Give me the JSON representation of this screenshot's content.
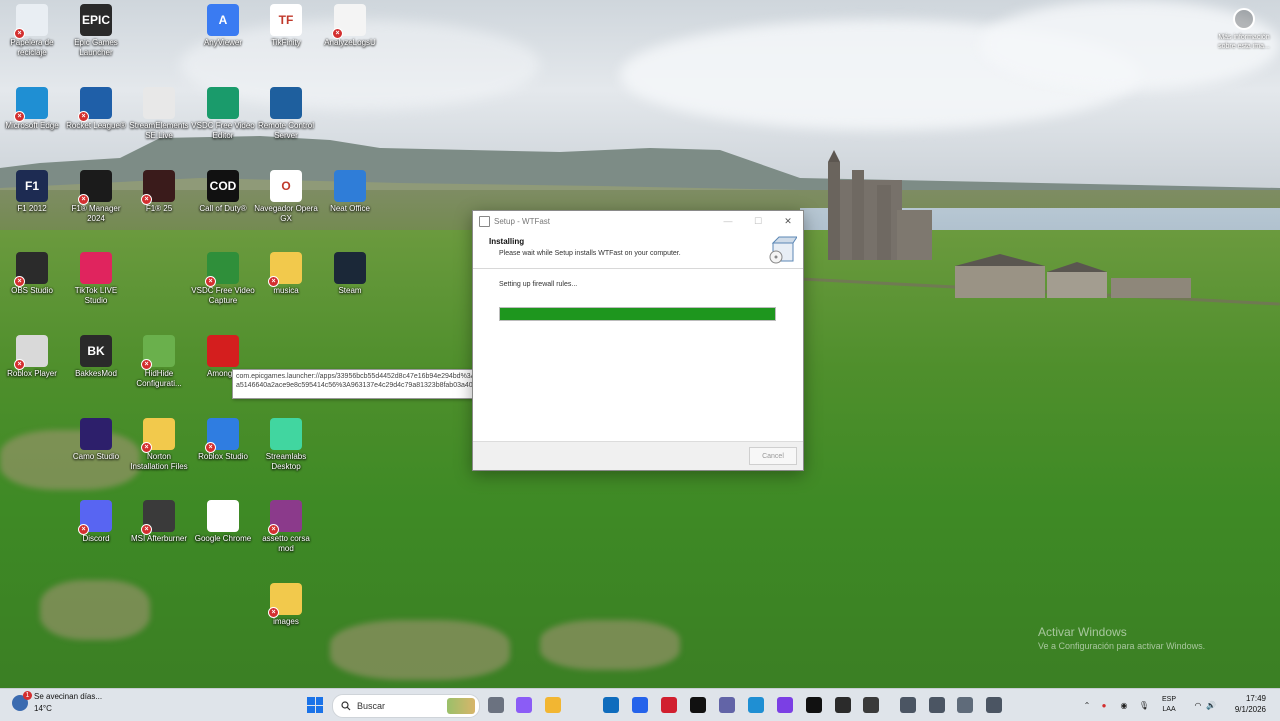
{
  "desktop": {
    "icons": [
      {
        "label": "Papelera de reciclaje",
        "color": "#e9eef3"
      },
      {
        "label": "Epic Games Launcher",
        "color": "#2a2a2a",
        "glyph": "EPIC"
      },
      {
        "label": "AnyViewer",
        "color": "#3a7bf2",
        "glyph": "A"
      },
      {
        "label": "TikFinity",
        "color": "#ffffff",
        "glyph": "TF"
      },
      {
        "label": "AnalyzeLogsU",
        "color": "#f4f4f4"
      },
      {
        "label": "Microsoft Edge",
        "color": "#1f8fd3"
      },
      {
        "label": "Rocket League®",
        "color": "#1f5fa8"
      },
      {
        "label": "StreamElements SE.Live",
        "color": "#e8e8e8"
      },
      {
        "label": "VSDC Free Video Editor",
        "color": "#1a9b6b"
      },
      {
        "label": "Remote Control Server",
        "color": "#1e5f9e"
      },
      {
        "label": "F1 2012",
        "color": "#1d2b52",
        "glyph": "F1"
      },
      {
        "label": "F1® Manager 2024",
        "color": "#1b1b1b"
      },
      {
        "label": "F1® 25",
        "color": "#3a1b1b"
      },
      {
        "label": "Call of Duty®",
        "color": "#111111",
        "glyph": "COD"
      },
      {
        "label": "Navegador Opera GX",
        "color": "#ffffff",
        "glyph": "O"
      },
      {
        "label": "Neat Office",
        "color": "#2f7dd8"
      },
      {
        "label": "OBS Studio",
        "color": "#2b2b2b"
      },
      {
        "label": "TikTok LIVE Studio",
        "color": "#e0245e"
      },
      {
        "label": "VSDC Free Video Capture",
        "color": "#2f8f3a"
      },
      {
        "label": "musica",
        "color": "#f2c94c"
      },
      {
        "label": "Steam",
        "color": "#1b2838"
      },
      {
        "label": "Roblox Player",
        "color": "#d9d9d9"
      },
      {
        "label": "BakkesMod",
        "color": "#2a2a2a",
        "glyph": "BK"
      },
      {
        "label": "HidHide Configurati...",
        "color": "#6ab04c"
      },
      {
        "label": "Among...",
        "color": "#d41e1e"
      },
      {
        "label": "Camo Studio",
        "color": "#2d1f6b"
      },
      {
        "label": "Norton Installation Files",
        "color": "#f2c94c"
      },
      {
        "label": "Roblox Studio",
        "color": "#2f7de1"
      },
      {
        "label": "Streamlabs Desktop",
        "color": "#41d6a0"
      },
      {
        "label": "Discord",
        "color": "#5865f2"
      },
      {
        "label": "MSI Afterburner",
        "color": "#3a3a3a"
      },
      {
        "label": "Google Chrome",
        "color": "#ffffff"
      },
      {
        "label": "assetto corsa mod",
        "color": "#8b3a8b"
      },
      {
        "label": "images",
        "color": "#f2c94c"
      }
    ],
    "tooltip": {
      "text": "com.epicgames.launcher://apps/33956bcb55d4452d8c47e16b94e294bd%3A729a86a5146640a2ace9e8c595414c56%3A963137e4c29d4c79a81323b8fab03a40?..."
    },
    "info_widget": {
      "label": "Más información sobre esta ima..."
    },
    "watermark": {
      "title": "Activar Windows",
      "subtitle": "Ve a Configuración para activar Windows."
    }
  },
  "setup_window": {
    "title": "Setup - WTFast",
    "close_glyph": "✕",
    "minimize_glyph": "—",
    "maximize_glyph": "☐",
    "heading": "Installing",
    "subheading": "Please wait while Setup installs WTFast on your computer.",
    "status": "Setting up firewall rules...",
    "progress": 1.0,
    "cancel_label": "Cancel",
    "progress_color": "#1e961e"
  },
  "taskbar": {
    "weather_text": "Se avecinan días...",
    "weather_temp": "14°C",
    "weather_badge": "1",
    "search_placeholder": "Buscar",
    "language_top": "ESP",
    "language_bottom": "LAA",
    "time": "17:49",
    "date": "9/1/2026",
    "app_icons": [
      {
        "name": "task-view-icon",
        "color": "#6b7280"
      },
      {
        "name": "copilot-icon",
        "color": "#8b5cf6"
      },
      {
        "name": "file-explorer-icon",
        "color": "#f2b632"
      },
      {
        "name": "outlook-icon",
        "color": "#0f6cbd"
      },
      {
        "name": "store-icon",
        "color": "#2563eb"
      },
      {
        "name": "opera-icon",
        "color": "#d11f2f"
      },
      {
        "name": "tiktok-icon",
        "color": "#111111"
      },
      {
        "name": "teams-icon",
        "color": "#6264a7"
      },
      {
        "name": "edge-icon",
        "color": "#1f8fd3"
      },
      {
        "name": "messenger-icon",
        "color": "#7b3fe4"
      },
      {
        "name": "call-of-duty-icon",
        "color": "#111111"
      },
      {
        "name": "obs-icon",
        "color": "#2b2b2b"
      },
      {
        "name": "media-player-icon",
        "color": "#3a3a3a"
      },
      {
        "name": "setup-task-icon",
        "color": "#4b5563"
      },
      {
        "name": "setup-task-2-icon",
        "color": "#4b5563"
      },
      {
        "name": "settings-icon",
        "color": "#5f6b7a"
      },
      {
        "name": "installer-icon",
        "color": "#4b5563"
      }
    ]
  }
}
